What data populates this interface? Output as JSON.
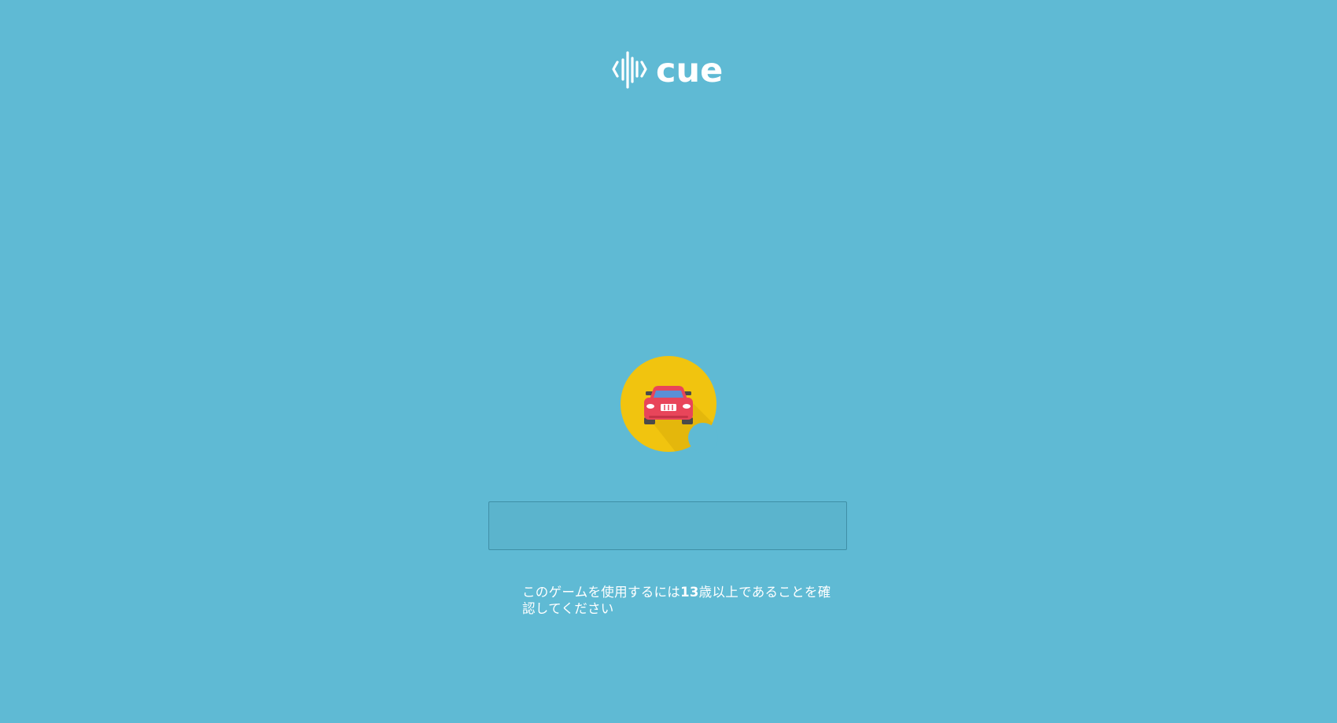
{
  "app": {
    "logo_text": "cue"
  },
  "avatar": {
    "icon": "red-car-icon",
    "background_color": "#f1c40f"
  },
  "name_input": {
    "value": "",
    "placeholder": ""
  },
  "age_notice": {
    "before": "このゲームを使用するには",
    "age": "13",
    "after": "歳以上であることを確認してください"
  },
  "colors": {
    "background": "#5fbad4",
    "text": "#ffffff",
    "car_body": "#e8455a",
    "car_window": "#5b8fd6"
  }
}
